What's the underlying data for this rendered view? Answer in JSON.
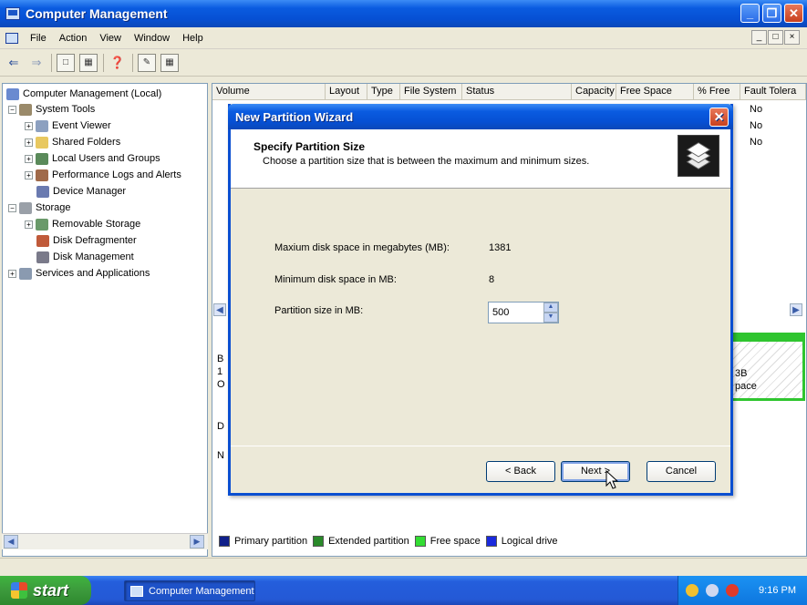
{
  "window": {
    "title": "Computer Management"
  },
  "menu": {
    "items": [
      "File",
      "Action",
      "View",
      "Window",
      "Help"
    ]
  },
  "mdi_controls": [
    "_",
    "□",
    "×"
  ],
  "tree": {
    "root": "Computer Management (Local)",
    "items": [
      {
        "label": "System Tools",
        "expander": "−"
      },
      {
        "label": "Event Viewer",
        "expander": "+"
      },
      {
        "label": "Shared Folders",
        "expander": "+"
      },
      {
        "label": "Local Users and Groups",
        "expander": "+"
      },
      {
        "label": "Performance Logs and Alerts",
        "expander": "+"
      },
      {
        "label": "Device Manager",
        "expander": ""
      },
      {
        "label": "Storage",
        "expander": "−"
      },
      {
        "label": "Removable Storage",
        "expander": "+"
      },
      {
        "label": "Disk Defragmenter",
        "expander": ""
      },
      {
        "label": "Disk Management",
        "expander": ""
      },
      {
        "label": "Services and Applications",
        "expander": "+"
      }
    ]
  },
  "columns": [
    "Volume",
    "Layout",
    "Type",
    "File System",
    "Status",
    "Capacity",
    "Free Space",
    "% Free",
    "Fault Tolera"
  ],
  "fault_values": [
    "No",
    "No",
    "No"
  ],
  "disk_fragments": {
    "b1": "B",
    "b2": "1",
    "b3": "O",
    "d1": "D",
    "n1": "N",
    "gb": "3B",
    "space": "pace"
  },
  "legend": {
    "items": [
      {
        "label": "Primary partition",
        "color": "#10208A"
      },
      {
        "label": "Extended partition",
        "color": "#2A8A2A"
      },
      {
        "label": "Free space",
        "color": "#33DD33"
      },
      {
        "label": "Logical drive",
        "color": "#1A2ADD"
      }
    ]
  },
  "dialog": {
    "title": "New Partition Wizard",
    "heading": "Specify Partition Size",
    "subheading": "Choose a partition size that is between the maximum and minimum sizes.",
    "max_label": "Maxium disk space in megabytes (MB):",
    "max_value": "1381",
    "min_label": "Minimum disk space in MB:",
    "min_value": "8",
    "size_label": "Partition size in MB:",
    "size_value": "500",
    "back_label": "< Back",
    "next_label": "Next >",
    "cancel_label": "Cancel"
  },
  "taskbar": {
    "start_label": "start",
    "task_label": "Computer Management",
    "clock": "9:16 PM"
  }
}
